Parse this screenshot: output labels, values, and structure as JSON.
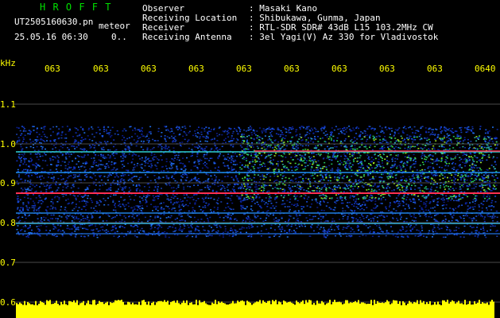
{
  "header": {
    "app_title": "H R O F F T",
    "filename": "UT2505160630.pn",
    "mode": "meteor",
    "datetime": "25.05.16 06:30",
    "count": "0..",
    "observer_label": "Observer",
    "observer_value": ": Masaki Kano",
    "location_label": "Receiving Location",
    "location_value": ": Shibukawa, Gunma, Japan",
    "receiver_label": "Receiver",
    "receiver_value": ": RTL-SDR SDR# 43dB L15 103.2MHz CW",
    "antenna_label": "Receiving Antenna",
    "antenna_value": ": 3el Yagi(V) Az 330 for Vladivostok"
  },
  "axis": {
    "unit": "kHz",
    "y_ticks": [
      "1.1",
      "1.0",
      "0.9",
      "0.8",
      "0.7",
      "0.6"
    ],
    "x_ticks": [
      "063",
      "063",
      "063",
      "063",
      "063",
      "063",
      "063",
      "063",
      "063",
      "0640"
    ]
  },
  "colors": {
    "background": "#000000",
    "label_yellow": "#ffff00",
    "title_green": "#00e000",
    "signal_red": "#ff2020",
    "noise_blue": "#1030c0"
  }
}
